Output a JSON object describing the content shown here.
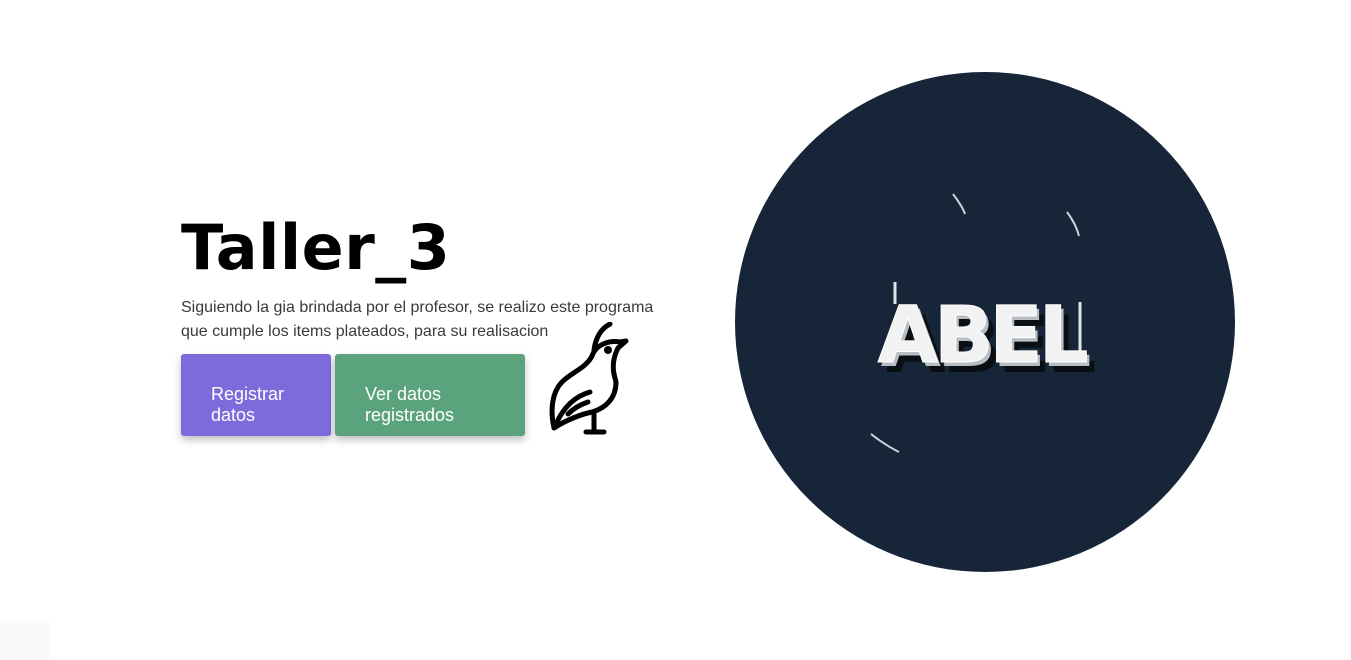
{
  "hero": {
    "title": "Taller_3",
    "description": "Siguiendo la gia brindada por el profesor, se realizo este programa que cumple los items plateados, para su realisacion"
  },
  "buttons": {
    "register_label": "Registrar\ndatos",
    "view_label": "Ver datos\nregistrados"
  },
  "avatar": {
    "logo_text": "ABEL"
  },
  "icons": {
    "bird": "quail-bird-icon"
  },
  "colors": {
    "register_button": "#7d6bdb",
    "view_button": "#5ba37d",
    "circle_background": "#162538",
    "title": "#000000"
  }
}
